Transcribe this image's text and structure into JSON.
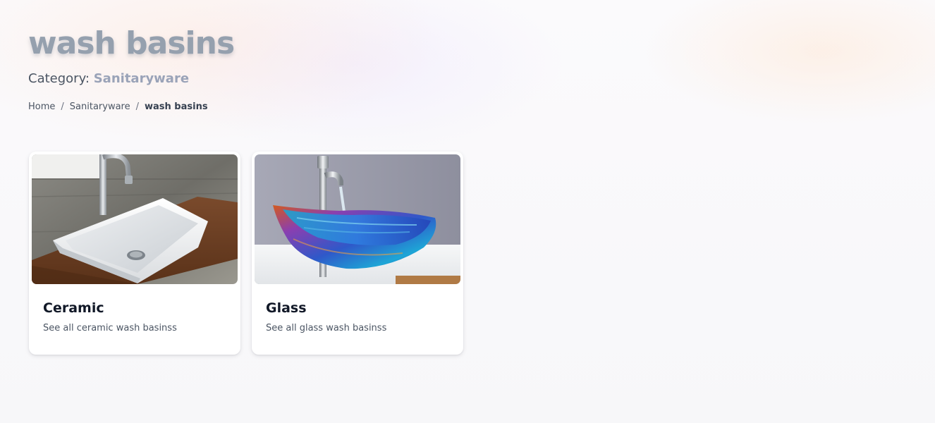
{
  "page": {
    "title": "wash basins",
    "category_label": "Category:",
    "category_value": "Sanitaryware"
  },
  "breadcrumb": {
    "items": [
      {
        "label": "Home"
      },
      {
        "label": "Sanitaryware"
      },
      {
        "label": "wash basins"
      }
    ],
    "separator": "/"
  },
  "cards": [
    {
      "title": "Ceramic",
      "description": "See all ceramic wash basinss",
      "image": "white-ceramic-vessel-basin"
    },
    {
      "title": "Glass",
      "description": "See all glass wash basinss",
      "image": "blue-glass-vessel-basin"
    }
  ],
  "colors": {
    "title": "#95a0ae",
    "category_value": "#9aa3b8",
    "card_bg": "#ffffff"
  }
}
